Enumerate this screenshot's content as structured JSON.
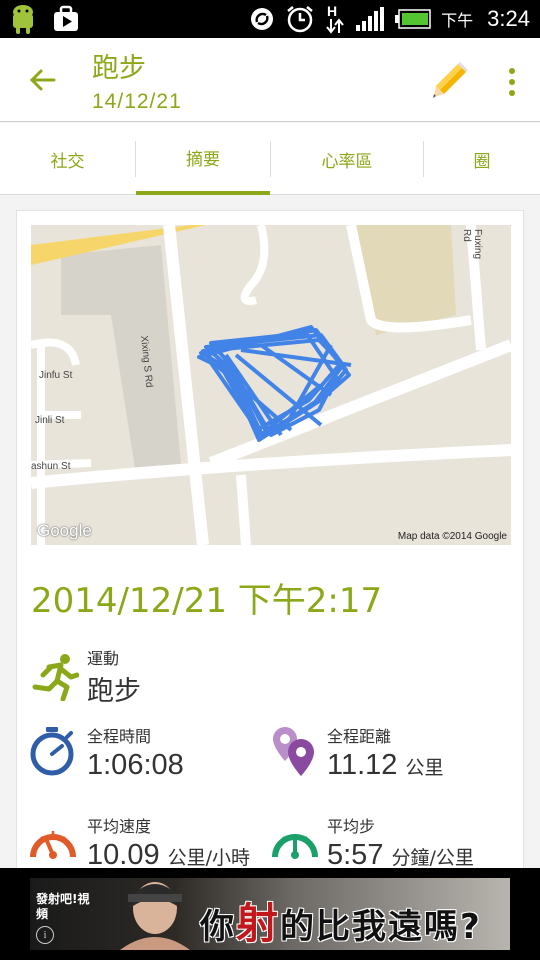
{
  "status_bar": {
    "ampm": "下午",
    "time": "3:24"
  },
  "app_bar": {
    "title": "跑步",
    "subtitle": "14/12/21"
  },
  "tabs": [
    {
      "label": "社交"
    },
    {
      "label": "摘要"
    },
    {
      "label": "心率區"
    },
    {
      "label": "圈"
    }
  ],
  "map": {
    "credit": "Map data ©2014 Google",
    "google_logo": "Google",
    "streets": {
      "xixing": "Xixing S Rd",
      "fuxing": "Fuxing Rd",
      "jinfu": "Jinfu St",
      "jinli": "Jinli St",
      "shun": "ashun St"
    }
  },
  "workout": {
    "datetime": "2014/12/21 下午2:17",
    "sport_label": "運動",
    "sport_value": "跑步",
    "duration_label": "全程時間",
    "duration_value": "1:06:08",
    "distance_label": "全程距離",
    "distance_value": "11.12",
    "distance_unit": "公里",
    "avg_speed_label": "平均速度",
    "avg_speed_value": "10.09",
    "avg_speed_unit": "公里/小時",
    "avg_pace_label": "平均步",
    "avg_pace_value": "5:57",
    "avg_pace_unit": "分鐘/公里"
  },
  "ad": {
    "headline_a": "你",
    "headline_b": "射",
    "headline_c": "的比我遠嗎?",
    "small_text": "發射吧!視頻",
    "info": "i"
  },
  "colors": {
    "accent": "#8aa818",
    "route": "#3a7ee8",
    "duration_icon": "#2f5da8",
    "distance_icon": "#8a4aa0",
    "speed_icon": "#e35a2a",
    "pace_icon": "#1aa06a"
  },
  "icons": {
    "back": "arrow-left-icon",
    "edit": "pencil-icon",
    "more": "overflow-menu-icon",
    "sport": "running-person-icon",
    "duration": "stopwatch-icon",
    "distance": "map-pins-icon",
    "speed": "speedometer-icon",
    "pace": "pace-gauge-icon"
  }
}
